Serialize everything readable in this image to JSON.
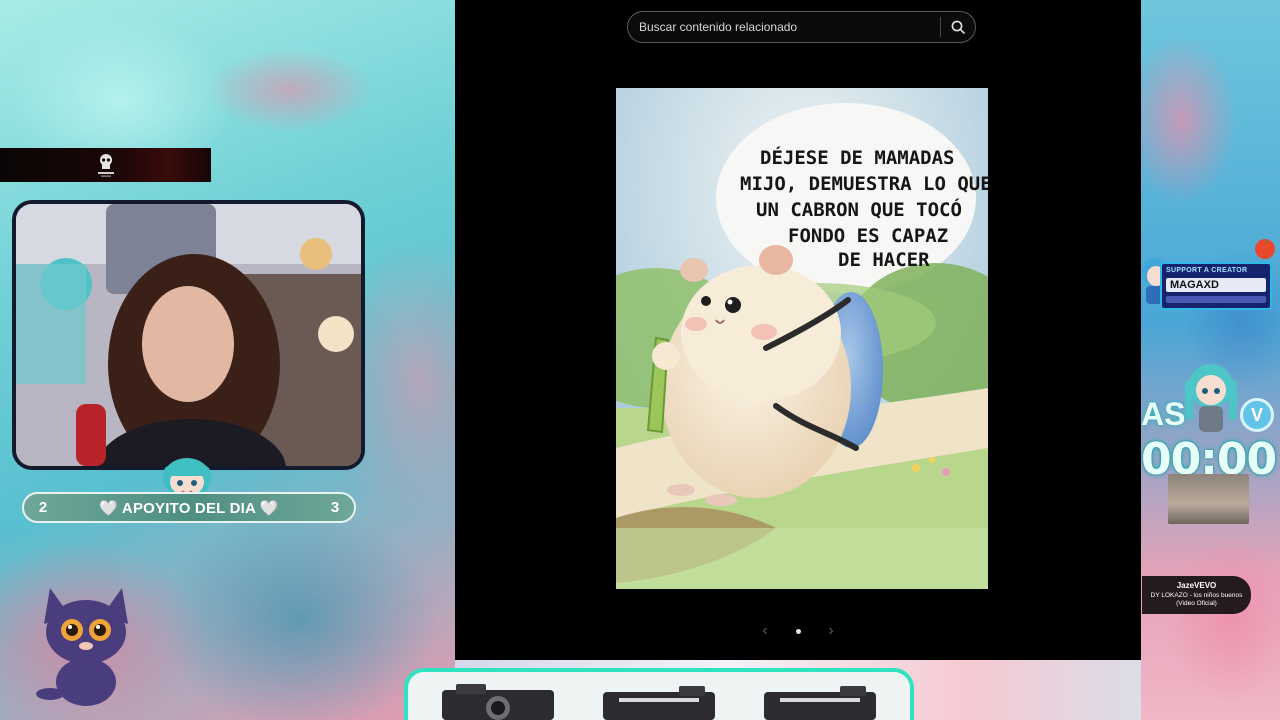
{
  "search": {
    "placeholder": "Buscar contenido relacionado"
  },
  "post": {
    "speech_lines": [
      "DÉJESE DE MAMADAS",
      "MIJO, DEMUESTRA LO QUE",
      "UN CABRON QUE TOCÓ",
      "FONDO ES CAPAZ",
      "DE HACER"
    ]
  },
  "overlay": {
    "apoyito": {
      "left_count": "2",
      "label": "🤍 APOYITO DEL DIA 🤍",
      "right_count": "3"
    },
    "support": {
      "title": "SUPPORT A CREATOR",
      "name": "MAGAXD"
    },
    "timer": "00:00",
    "timer_prefix": "AS",
    "badge": "V",
    "music": {
      "artist": "JazeVEVO",
      "track": "DY LOKAZO - los niños buenos (Video Oficial)"
    }
  },
  "colors": {
    "panel_bg": "#000000",
    "accent_teal": "#2fe3c0",
    "apoyito_bar": "#4e8f82",
    "support_card": "#16246e"
  }
}
